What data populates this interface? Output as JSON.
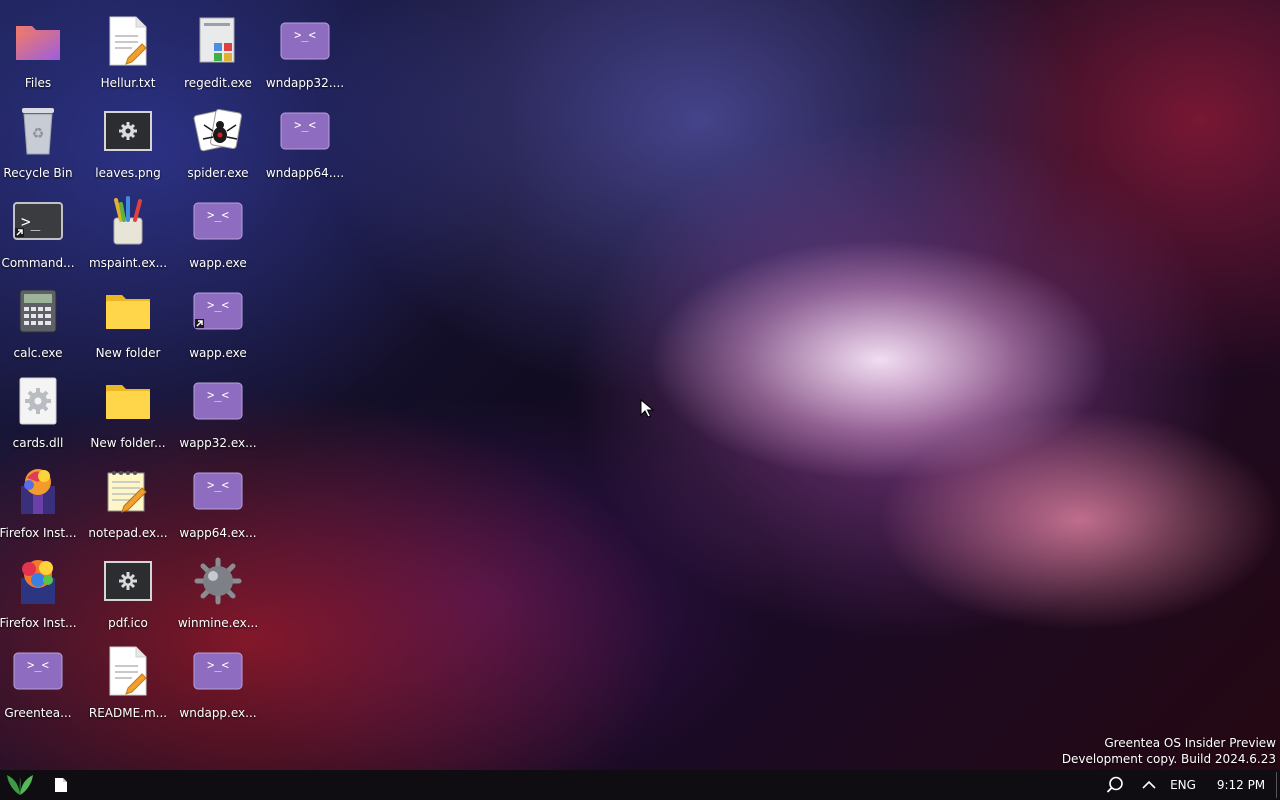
{
  "desktop": {
    "icons": [
      {
        "label": "Files",
        "icon": "files-folder-icon"
      },
      {
        "label": "Recycle Bin",
        "icon": "recycle-bin-icon"
      },
      {
        "label": "Command...",
        "icon": "command-prompt-icon"
      },
      {
        "label": "calc.exe",
        "icon": "calculator-icon"
      },
      {
        "label": "cards.dll",
        "icon": "dll-gear-icon"
      },
      {
        "label": "Firefox Inst...",
        "icon": "firefox-installer-icon"
      },
      {
        "label": "Firefox Inst...",
        "icon": "firefox-installer-icon"
      },
      {
        "label": "Greentea...",
        "icon": "app-window-icon"
      },
      {
        "label": "Hellur.txt",
        "icon": "text-file-icon"
      },
      {
        "label": "leaves.png",
        "icon": "image-file-icon"
      },
      {
        "label": "mspaint.ex...",
        "icon": "paint-icon"
      },
      {
        "label": "New folder",
        "icon": "folder-icon"
      },
      {
        "label": "New folder...",
        "icon": "folder-icon"
      },
      {
        "label": "notepad.ex...",
        "icon": "notepad-icon"
      },
      {
        "label": "pdf.ico",
        "icon": "image-file-icon"
      },
      {
        "label": "README.m...",
        "icon": "text-file-icon"
      },
      {
        "label": "regedit.exe",
        "icon": "registry-editor-icon"
      },
      {
        "label": "spider.exe",
        "icon": "spider-solitaire-icon"
      },
      {
        "label": "wapp.exe",
        "icon": "app-window-icon"
      },
      {
        "label": "wapp.exe",
        "icon": "app-window-shortcut-icon"
      },
      {
        "label": "wapp32.ex...",
        "icon": "app-window-icon"
      },
      {
        "label": "wapp64.ex...",
        "icon": "app-window-icon"
      },
      {
        "label": "winmine.ex...",
        "icon": "minesweeper-icon"
      },
      {
        "label": "wndapp.ex...",
        "icon": "app-window-icon"
      },
      {
        "label": "wndapp32....",
        "icon": "app-window-icon"
      },
      {
        "label": "wndapp64....",
        "icon": "app-window-icon"
      }
    ]
  },
  "watermark": {
    "line1": "Greentea OS Insider Preview",
    "line2": "Development copy. Build 2024.6.23"
  },
  "taskbar": {
    "start_icon": "leaf-logo-icon",
    "pinned_icon": "file-icon",
    "tray": {
      "search_icon": "search-icon",
      "overflow_icon": "chevron-up-icon",
      "language": "ENG",
      "clock": "9:12 PM"
    }
  },
  "colors": {
    "app_icon_purple": "#8e6cc0",
    "taskbar_bg": "#0f0d11",
    "leaf_green": "#4fa84f"
  }
}
